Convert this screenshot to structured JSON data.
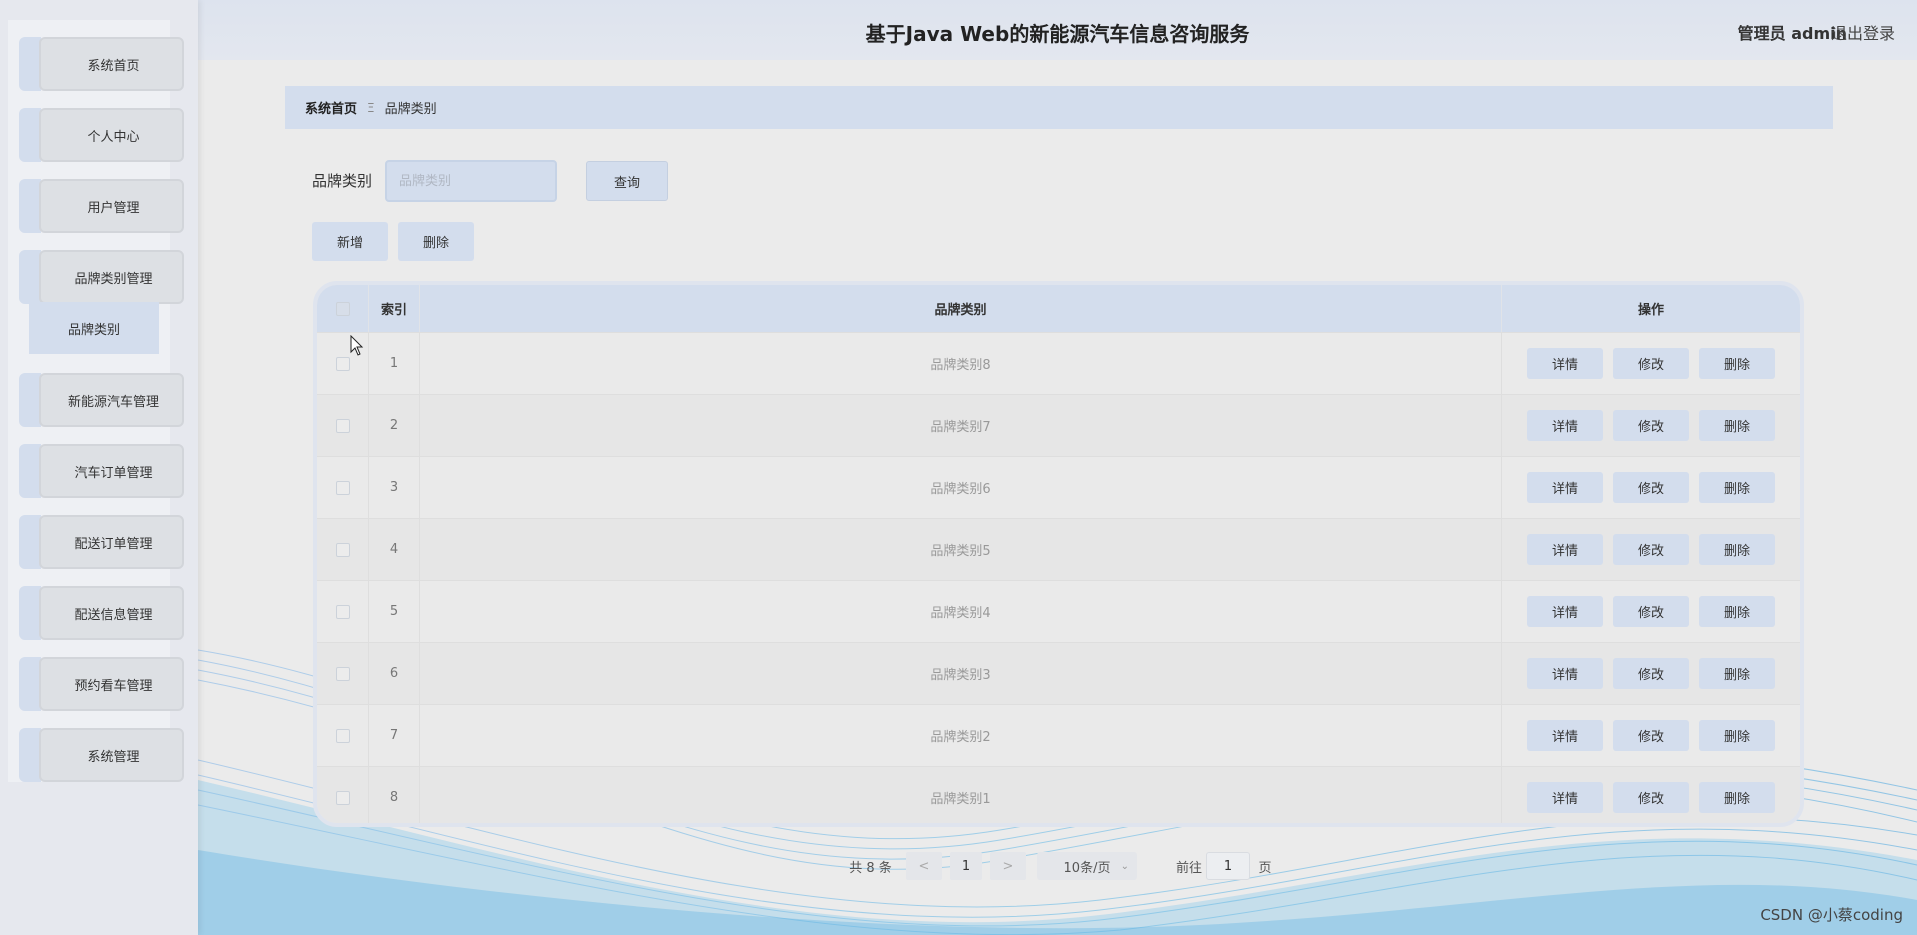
{
  "header": {
    "title": "基于Java Web的新能源汽车信息咨询服务",
    "user": "管理员 admin",
    "logout": "退出登录"
  },
  "sidebar": {
    "items": [
      {
        "label": "系统首页"
      },
      {
        "label": "个人中心"
      },
      {
        "label": "用户管理"
      },
      {
        "label": "品牌类别管理"
      },
      {
        "label": "新能源汽车管理"
      },
      {
        "label": "汽车订单管理"
      },
      {
        "label": "配送订单管理"
      },
      {
        "label": "配送信息管理"
      },
      {
        "label": "预约看车管理"
      },
      {
        "label": "系统管理"
      }
    ],
    "submenu_active": "品牌类别"
  },
  "breadcrumb": {
    "home": "系统首页",
    "separator": "Ξ",
    "current": "品牌类别"
  },
  "search": {
    "label": "品牌类别",
    "placeholder": "品牌类别",
    "query_button": "查询"
  },
  "actions": {
    "add": "新增",
    "delete": "删除"
  },
  "table": {
    "headers": {
      "index": "索引",
      "name": "品牌类别",
      "ops": "操作"
    },
    "op_labels": {
      "detail": "详情",
      "edit": "修改",
      "delete": "删除"
    },
    "rows": [
      {
        "index": "1",
        "name": "品牌类别8"
      },
      {
        "index": "2",
        "name": "品牌类别7"
      },
      {
        "index": "3",
        "name": "品牌类别6"
      },
      {
        "index": "4",
        "name": "品牌类别5"
      },
      {
        "index": "5",
        "name": "品牌类别4"
      },
      {
        "index": "6",
        "name": "品牌类别3"
      },
      {
        "index": "7",
        "name": "品牌类别2"
      },
      {
        "index": "8",
        "name": "品牌类别1"
      }
    ]
  },
  "pagination": {
    "total": "共 8 条",
    "prev": "<",
    "page": "1",
    "next": ">",
    "page_size": "10条/页",
    "goto_label": "前往",
    "goto_value": "1",
    "goto_suffix": "页"
  },
  "watermark": "CSDN @小蔡coding",
  "colors": {
    "accent": "#d3dded",
    "background": "#ebebeb"
  }
}
